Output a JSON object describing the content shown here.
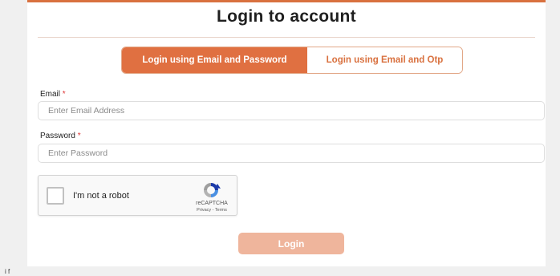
{
  "header": {
    "title": "Login to account"
  },
  "tabs": [
    {
      "label": "Login using Email and Password",
      "active": true
    },
    {
      "label": "Login using Email and Otp",
      "active": false
    }
  ],
  "form": {
    "email_label": "Email",
    "email_placeholder": "Enter Email Address",
    "password_label": "Password",
    "password_placeholder": "Enter Password",
    "required_marker": "*"
  },
  "captcha": {
    "label": "I'm not a robot",
    "brand": "reCAPTCHA",
    "links": "Privacy - Terms",
    "icon": "recaptcha-logo"
  },
  "submit": {
    "label": "Login"
  },
  "colors": {
    "accent": "#e07041",
    "accent_light": "#efb59c",
    "border_top": "#d9713f"
  },
  "footer": {
    "stray_text": "i f"
  }
}
